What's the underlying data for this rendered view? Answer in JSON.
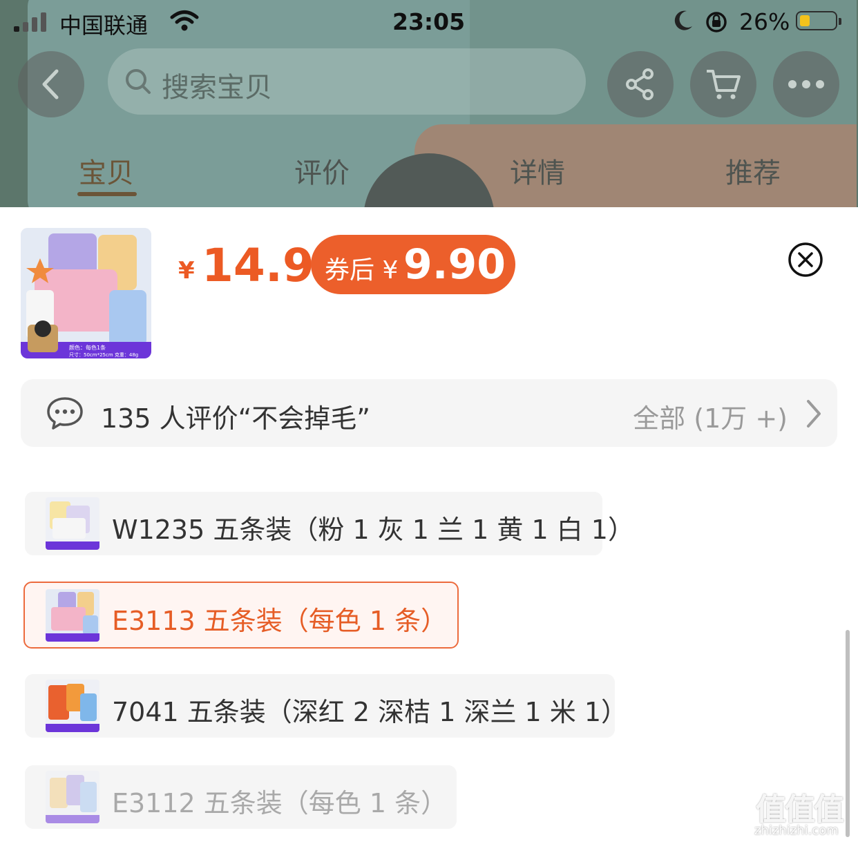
{
  "status_bar": {
    "carrier": "中国联通",
    "time": "23:05",
    "battery": "26%",
    "battery_level": 0.26
  },
  "header": {
    "search_placeholder": "搜索宝贝",
    "tabs": [
      {
        "label": "宝贝",
        "active": true
      },
      {
        "label": "评价",
        "active": false
      },
      {
        "label": "详情",
        "active": false
      },
      {
        "label": "推荐",
        "active": false
      }
    ]
  },
  "product": {
    "currency": "¥",
    "price": "14.9",
    "coupon_label": "券后",
    "coupon_price": "9.90",
    "thumb_caption_line1": "颜色：每色1条",
    "thumb_caption_line2": "尺寸：50cm*25cm 克重：48g"
  },
  "reviews": {
    "summary": "135 人评价“不会掉毛”",
    "all_label": "全部 (1万 +)"
  },
  "skus": [
    {
      "label": "W1235 五条装（粉 1 灰 1 兰 1 黄 1 白 1）",
      "state": "normal"
    },
    {
      "label": "E3113 五条装（每色 1 条）",
      "state": "selected"
    },
    {
      "label": "7041 五条装（深红 2 深桔 1 深兰 1 米 1）",
      "state": "normal"
    },
    {
      "label": "E3112 五条装（每色 1 条）",
      "state": "disabled"
    }
  ],
  "colors": {
    "accent": "#ec5a24",
    "coupon_bg": "#ec5f2b",
    "sku_bg": "#f5f5f5",
    "selected_border": "#ec6a3c"
  },
  "watermark": {
    "main": "值值值",
    "sub": "zhizhizhi.com"
  }
}
